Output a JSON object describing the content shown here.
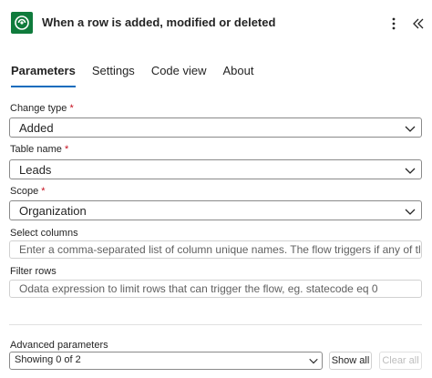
{
  "header": {
    "title": "When a row is added, modified or deleted",
    "app_icon": "dataverse-icon",
    "accent_color": "#0f7b3c"
  },
  "tabs": [
    {
      "label": "Parameters",
      "active": true
    },
    {
      "label": "Settings",
      "active": false
    },
    {
      "label": "Code view",
      "active": false
    },
    {
      "label": "About",
      "active": false
    }
  ],
  "fields": {
    "change_type": {
      "label": "Change type",
      "required_mark": "*",
      "value": "Added"
    },
    "table_name": {
      "label": "Table name",
      "required_mark": "*",
      "value": "Leads"
    },
    "scope": {
      "label": "Scope",
      "required_mark": "*",
      "value": "Organization"
    },
    "select_columns": {
      "label": "Select columns",
      "placeholder": "Enter a comma-separated list of column unique names. The flow triggers if any of them ar..."
    },
    "filter_rows": {
      "label": "Filter rows",
      "placeholder": "Odata expression to limit rows that can trigger the flow, eg. statecode eq 0"
    }
  },
  "advanced": {
    "label": "Advanced parameters",
    "selected": "Showing 0 of 2",
    "show_all": "Show all",
    "clear_all": "Clear all"
  }
}
